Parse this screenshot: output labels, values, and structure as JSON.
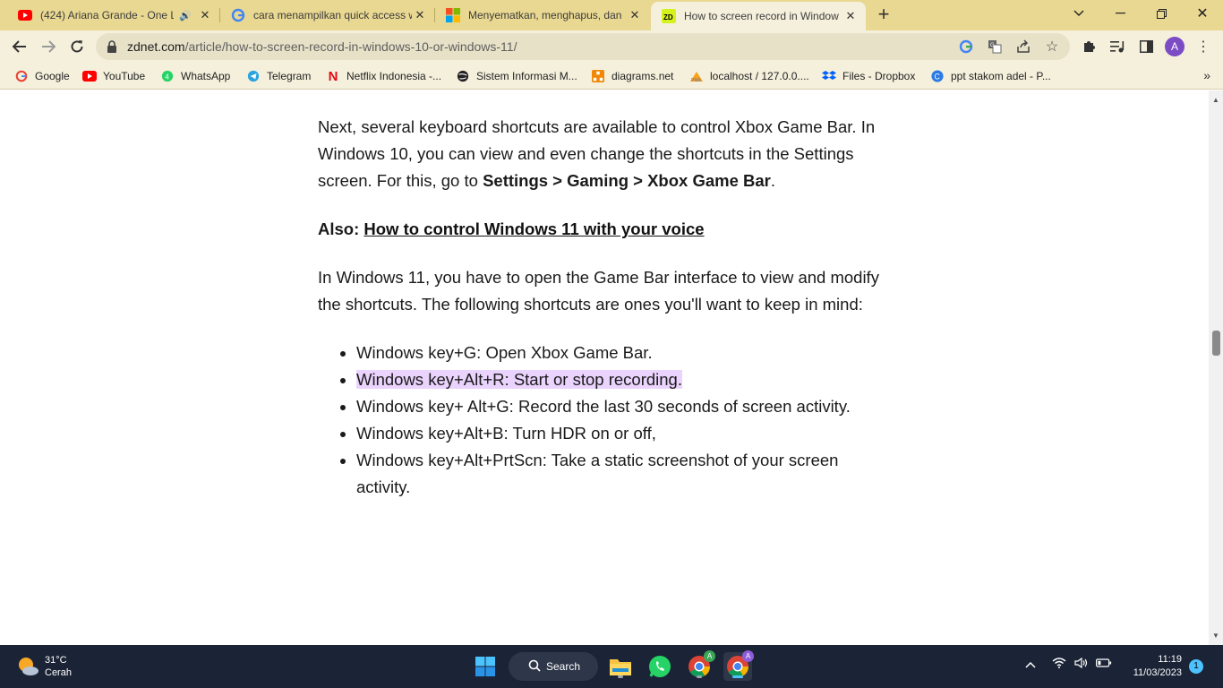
{
  "tabs": [
    {
      "title": "(424) Ariana Grande - One La",
      "icon": "youtube-icon",
      "muted_icon": "speaker-icon"
    },
    {
      "title": "cara menampilkan quick access w",
      "icon": "google-icon"
    },
    {
      "title": "Menyematkan, menghapus, dan ",
      "icon": "microsoft-icon"
    },
    {
      "title": "How to screen record in Window",
      "icon": "zdnet-icon",
      "active": true
    }
  ],
  "toolbar": {
    "url_host": "zdnet.com",
    "url_path": "/article/how-to-screen-record-in-windows-10-or-windows-11/",
    "profile_initial": "A"
  },
  "bookmarks": [
    {
      "label": "Google",
      "icon": "google-icon"
    },
    {
      "label": "YouTube",
      "icon": "youtube-icon"
    },
    {
      "label": "WhatsApp",
      "icon": "whatsapp-icon"
    },
    {
      "label": "Telegram",
      "icon": "telegram-icon"
    },
    {
      "label": "Netflix Indonesia -...",
      "icon": "netflix-icon"
    },
    {
      "label": "Sistem Informasi M...",
      "icon": "globe-icon"
    },
    {
      "label": "diagrams.net",
      "icon": "diagrams-icon"
    },
    {
      "label": "localhost / 127.0.0....",
      "icon": "phpmyadmin-icon"
    },
    {
      "label": "Files - Dropbox",
      "icon": "dropbox-icon"
    },
    {
      "label": "ppt stakom adel - P...",
      "icon": "canva-icon"
    }
  ],
  "article": {
    "p1_text": "Next, several keyboard shortcuts are available to control Xbox Game Bar. In Windows 10, you can view and even change the shortcuts in the Settings screen. For this, go to ",
    "p1_bold": "Settings > Gaming > Xbox Game Bar",
    "p1_end": ".",
    "also_label": "Also:",
    "also_link": "How to control Windows 11 with your voice",
    "p2_text": "In Windows 11, you have to open the Game Bar interface to view and modify the shortcuts. The following shortcuts are ones you'll want to keep in mind:",
    "shortcuts": [
      "Windows key+G: Open Xbox Game Bar.",
      "Windows key+Alt+R: Start or stop recording.",
      "Windows key+ Alt+G: Record the last 30 seconds of screen activity.",
      "Windows key+Alt+B: Turn HDR on or off,",
      "Windows key+Alt+PrtScn: Take a static screenshot of your screen activity."
    ]
  },
  "taskbar": {
    "temperature": "31°C",
    "weather": "Cerah",
    "search_label": "Search",
    "time": "11:19",
    "date": "11/03/2023",
    "notifications": "1",
    "chrome_profile_a": "A"
  },
  "colors": {
    "tab_strip": "#e9d891",
    "toolbar": "#f5f0dc",
    "highlight": "#ead3fc",
    "taskbar": "#1b2436"
  }
}
